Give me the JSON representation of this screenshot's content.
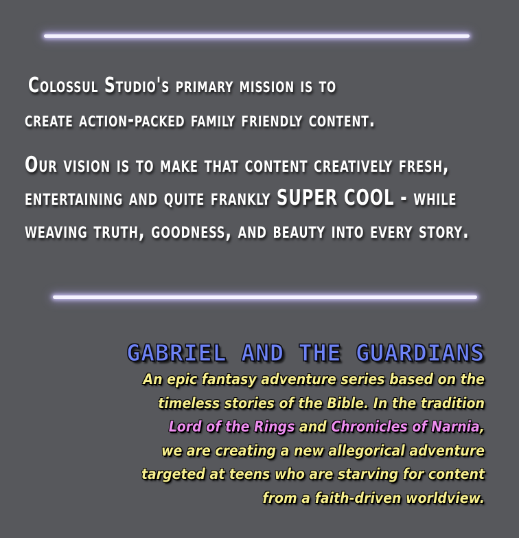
{
  "mission": {
    "paragraph1": [
      "Colossul Studio's primary mission is to",
      "create action-packed family friendly content."
    ],
    "paragraph2": [
      "Our vision is to make that content creatively fresh,",
      "entertaining and quite frankly SUPER COOL - while",
      "weaving truth, goodness, and beauty into every story."
    ]
  },
  "project": {
    "title": "GABRIEL AND THE GUARDIANS",
    "line1": "An epic fantasy adventure series based on the",
    "line2": "timeless stories of the Bible. In the tradition",
    "line3_highlight1": "Lord of the Rings",
    "line3_and": " and ",
    "line3_highlight2": "Chronicles of Narnia",
    "line3_end": ",",
    "line4": "we are creating a new allegorical adventure",
    "line5": "targeted at teens who are starving for content",
    "line6": "from a faith-driven worldview."
  },
  "colors": {
    "background": "#57585c",
    "mission_text": "#ffffff",
    "title": "#6f84f6",
    "description": "#f7ef8e",
    "highlight": "#ee8ef0",
    "divider_glow": "#f4f2ff"
  }
}
